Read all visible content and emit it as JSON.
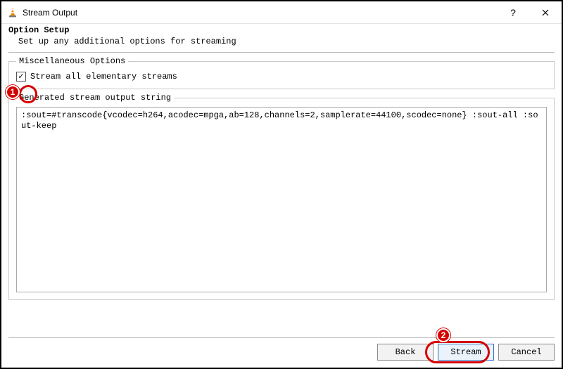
{
  "window": {
    "title": "Stream Output"
  },
  "heading": {
    "title": "Option Setup",
    "subtitle": "Set up any additional options for streaming"
  },
  "misc": {
    "legend": "Miscellaneous Options",
    "stream_all_label": "Stream all elementary streams",
    "stream_all_checked": true
  },
  "output": {
    "legend": "Generated stream output string",
    "value": ":sout=#transcode{vcodec=h264,acodec=mpga,ab=128,channels=2,samplerate=44100,scodec=none} :sout-all :sout-keep"
  },
  "buttons": {
    "back": "Back",
    "stream": "Stream",
    "cancel": "Cancel"
  },
  "annotations": {
    "marker1": "1",
    "marker2": "2"
  }
}
